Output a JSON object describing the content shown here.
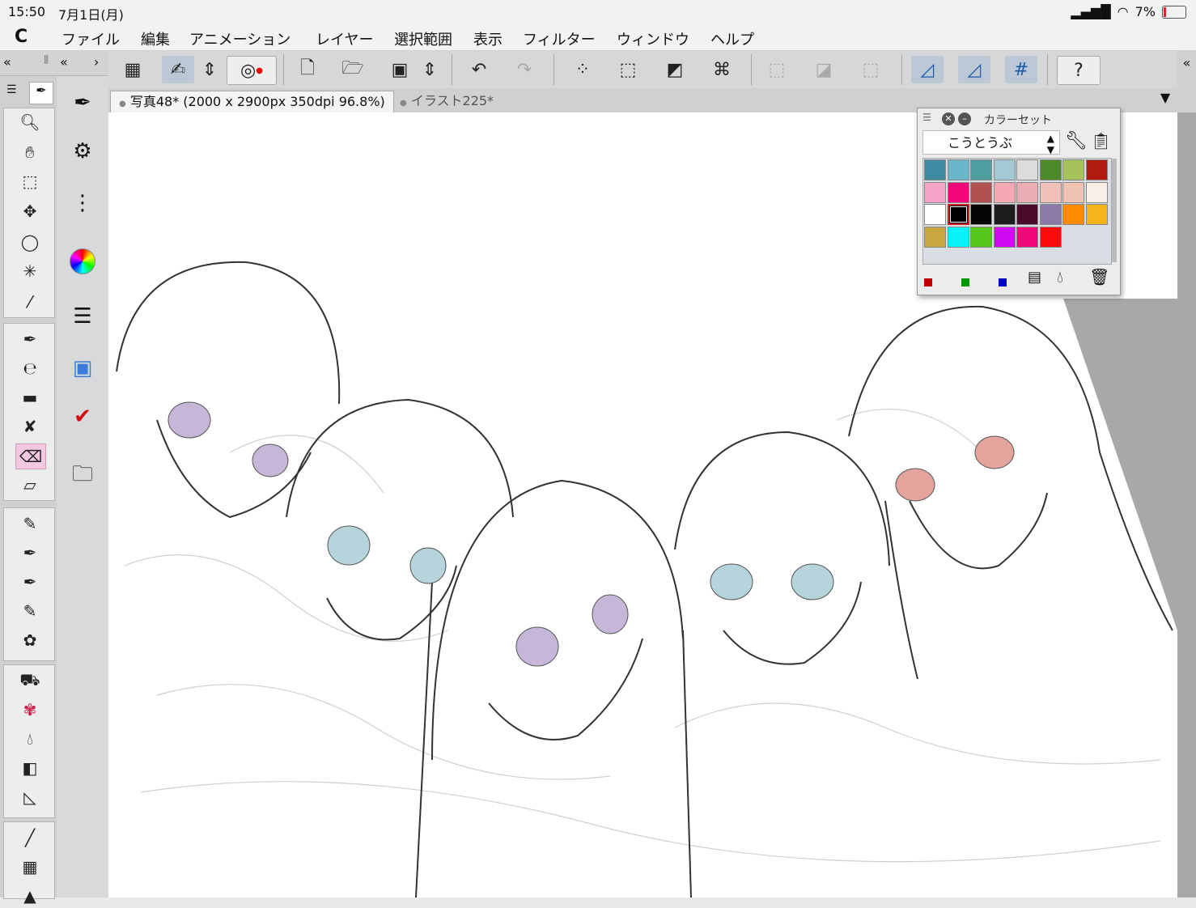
{
  "status": {
    "time": "15:50",
    "date": "7月1日(月)",
    "battery": "7%"
  },
  "menu": {
    "logo": "C",
    "items": [
      "ファイル",
      "編集",
      "アニメーション",
      "レイヤー",
      "選択範囲",
      "表示",
      "フィルター",
      "ウィンドウ",
      "ヘルプ"
    ]
  },
  "tabs": [
    {
      "label": "写真48* (2000 x 2900px 350dpi 96.8%)"
    },
    {
      "label": "イラスト225*"
    }
  ],
  "colorset": {
    "title": "カラーセット",
    "set_name": "こうとうぶ",
    "swatches": [
      "#3f8aa0",
      "#6bb6c9",
      "#4f9d9e",
      "#a5c8d5",
      "#dcdcdc",
      "#4d8a2a",
      "#a6c25a",
      "#b01a10",
      "#f5a3c7",
      "#f0087a",
      "#b25250",
      "#f4a8b4",
      "#e9adb3",
      "#f1c0b8",
      "#f0c4b2",
      "#faefe7",
      "#ffffff",
      "#000000",
      "#050505",
      "#1d1d1d",
      "#4a0a2c",
      "#8b7aa8",
      "#ff8c00",
      "#f4b41a",
      "#c9a842",
      "#06f1f8",
      "#56c71a",
      "#cf08f2",
      "#f0087a",
      "#fb0b0b"
    ],
    "selected_index": 17,
    "mini_colors": [
      "#c00000",
      "#009900",
      "#0000cc"
    ]
  }
}
